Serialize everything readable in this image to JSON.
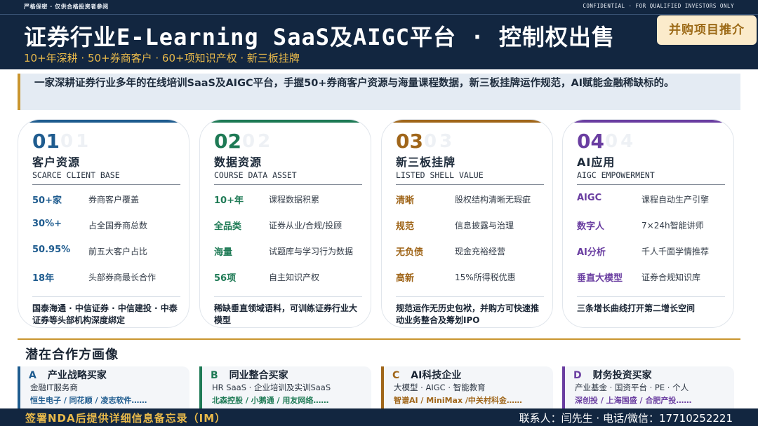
{
  "header": {
    "confidential_cn": "严格保密 · 仅供合格投资者参阅",
    "confidential_en": "CONFIDENTIAL · FOR QUALIFIED INVESTORS ONLY",
    "title": "证券行业E-Learning SaaS及AIGC平台 · 控制权出售",
    "subtitle": "10+年深耕 · 50+券商客户 · 60+项知识产权 · 新三板挂牌",
    "badge": "并购项目推介"
  },
  "summary": "一家深耕证券行业多年的在线培训SaaS及AIGC平台，手握50+券商客户资源与海量课程数据，新三板挂牌运作规范，AI赋能金融稀缺标的。",
  "colors": {
    "navy": "#122640",
    "gold": "#c9952f",
    "card1": "#1f5c8f",
    "card2": "#1e7a55",
    "card3": "#a0661a",
    "card4": "#6a3ea1"
  },
  "cards": [
    {
      "num": "01",
      "ghost": "01",
      "name": "客户资源",
      "en": "SCARCE CLIENT BASE",
      "rows": [
        {
          "k": "50+家",
          "v": "券商客户覆盖"
        },
        {
          "k": "30%+",
          "v": "占全国券商总数"
        },
        {
          "k": "50.95%",
          "v": "前五大客户占比"
        },
        {
          "k": "18年",
          "v": "头部券商最长合作"
        }
      ],
      "note": "国泰海通 · 中信证券 · 中信建投 · 中泰证券等头部机构深度绑定"
    },
    {
      "num": "02",
      "ghost": "02",
      "name": "数据资源",
      "en": "COURSE DATA ASSET",
      "rows": [
        {
          "k": "10+年",
          "v": "课程数据积累"
        },
        {
          "k": "全品类",
          "v": "证券从业/合规/投顾"
        },
        {
          "k": "海量",
          "v": "试题库与学习行为数据"
        },
        {
          "k": "56项",
          "v": "自主知识产权"
        }
      ],
      "note": "稀缺垂直领域语料，可训练证券行业大模型"
    },
    {
      "num": "03",
      "ghost": "03",
      "name": "新三板挂牌",
      "en": "LISTED SHELL VALUE",
      "rows": [
        {
          "k": "清晰",
          "v": "股权结构清晰无瑕疵"
        },
        {
          "k": "规范",
          "v": "信息披露与治理"
        },
        {
          "k": "无负债",
          "v": "现金充裕经营"
        },
        {
          "k": "高新",
          "v": "15%所得税优惠"
        }
      ],
      "note": "规范运作无历史包袱，并购方可快速推动业务整合及筹划IPO"
    },
    {
      "num": "04",
      "ghost": "04",
      "name": "AI应用",
      "en": "AIGC EMPOWERMENT",
      "rows": [
        {
          "k": "AIGC",
          "v": "课程自动生产引擎"
        },
        {
          "k": "数字人",
          "v": "7×24h智能讲师"
        },
        {
          "k": "AI分析",
          "v": "千人千面学情推荐"
        },
        {
          "k": "垂直大模型",
          "v": "证券合规知识库"
        }
      ],
      "note": "三条增长曲线打开第二增长空间"
    }
  ],
  "section_title": "潜在合作方画像",
  "buyers": [
    {
      "letter": "A",
      "title": "产业战略买家",
      "desc": "金融IT服务商",
      "examples": "恒生电子 / 同花顺 / 凌志软件……"
    },
    {
      "letter": "B",
      "title": "同业整合买家",
      "desc": "HR SaaS · 企业培训及实训SaaS",
      "examples": "北森控股 / 小鹅通 / 用友网络……"
    },
    {
      "letter": "C",
      "title": "AI科技企业",
      "desc": "大模型 · AIGC · 智能教育",
      "examples": "智谱AI / MiniMax /中关村科金……"
    },
    {
      "letter": "D",
      "title": "财务投资买家",
      "desc": "产业基金 · 国资平台 · PE · 个人",
      "examples": "深创投 / 上海国盛 / 合肥产投……"
    }
  ],
  "footer": {
    "left": "签署NDA后提供详细信息备忘录（IM）",
    "right": "联系人：闫先生 · 电话/微信：17710252221"
  }
}
